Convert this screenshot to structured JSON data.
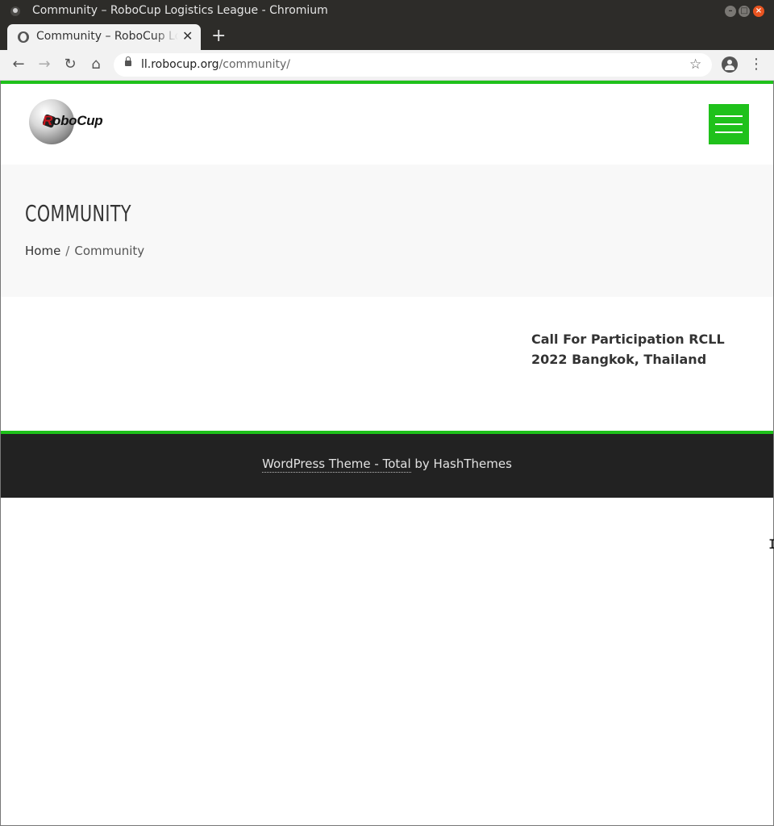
{
  "window": {
    "title": "Community – RoboCup Logistics League - Chromium",
    "minimize_icon": "minimize-icon",
    "maximize_icon": "maximize-icon",
    "close_icon": "close-icon"
  },
  "tab": {
    "title": "Community – RoboCup Logistics League",
    "close_glyph": "✕",
    "new_tab_glyph": "+"
  },
  "toolbar": {
    "back_glyph": "←",
    "forward_glyph": "→",
    "reload_glyph": "↻",
    "home_glyph": "⌂",
    "url_host": "ll.robocup.org",
    "url_path": "/community/",
    "star_glyph": "☆",
    "menu_glyph": "⋮"
  },
  "site": {
    "logo_text_r": "R",
    "logo_text_rest": "oboCup",
    "accent_color": "#1fc11b"
  },
  "banner": {
    "title": "COMMUNITY",
    "breadcrumb": {
      "home": "Home",
      "separator": "/",
      "current": "Community"
    }
  },
  "sidebar": {
    "recent_post": "Call For Participation RCLL 2022 Bangkok, Thailand"
  },
  "footer": {
    "theme_link": "WordPress Theme - Total",
    "by_text": " by HashThemes"
  },
  "cursor": {
    "glyph": "I"
  }
}
